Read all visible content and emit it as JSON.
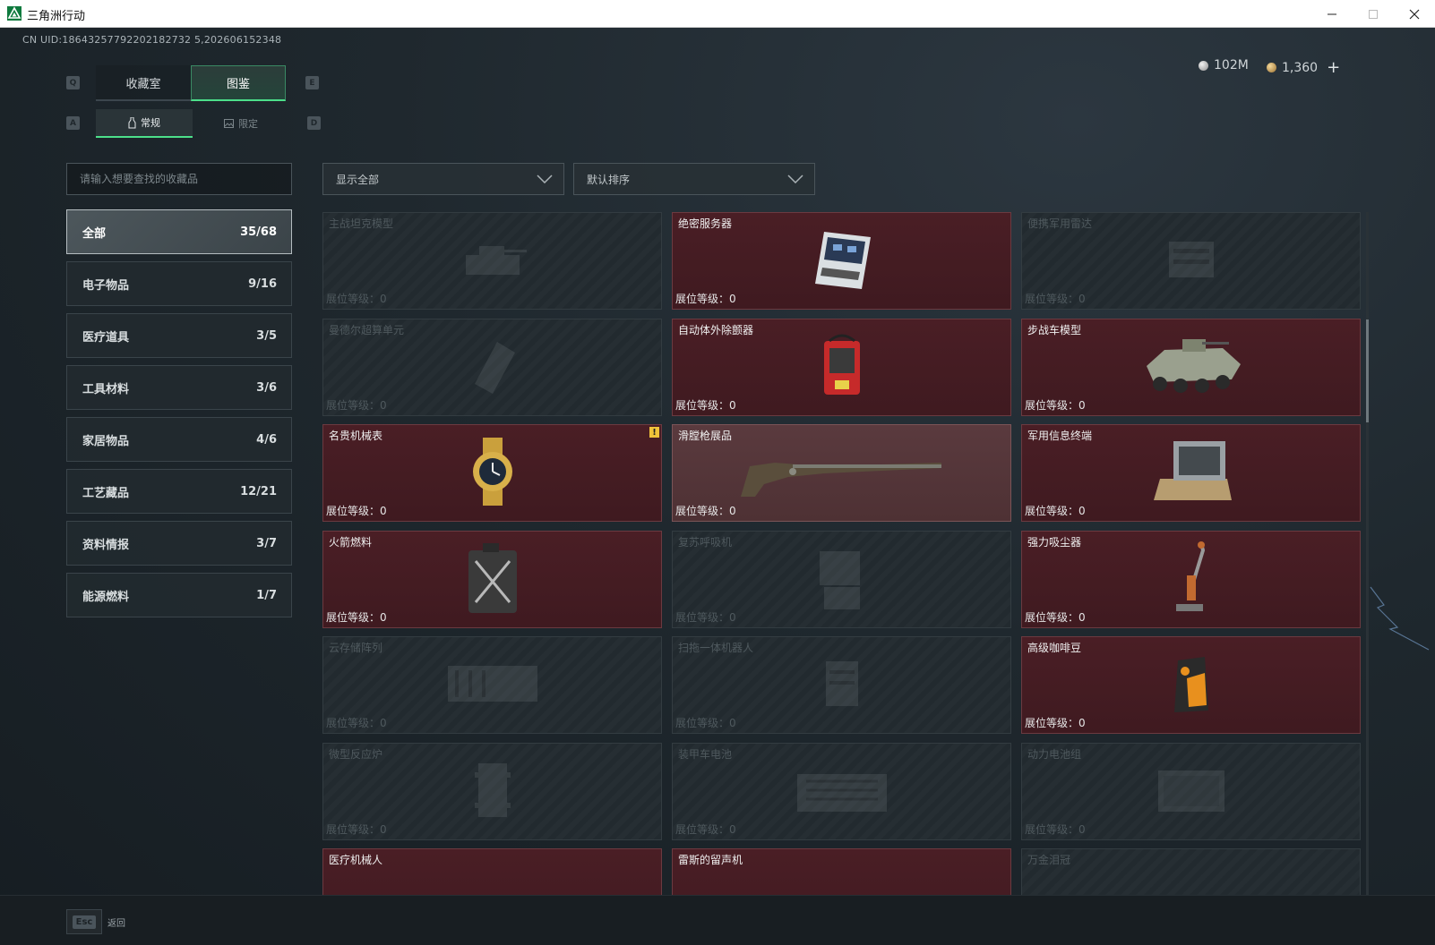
{
  "window": {
    "title": "三角洲行动"
  },
  "uid_text": "CN UID:18643257792202182732 5,202606152348",
  "currency": {
    "silver": "102M",
    "gold": "1,360",
    "plus": "+"
  },
  "keys": {
    "q": "Q",
    "e": "E",
    "a": "A",
    "d": "D",
    "esc": "Esc"
  },
  "tabs": [
    {
      "label": "收藏室"
    },
    {
      "label": "图鉴"
    }
  ],
  "subtabs": [
    {
      "label": "常规"
    },
    {
      "label": "限定"
    }
  ],
  "search": {
    "placeholder": "请输入想要查找的收藏品"
  },
  "categories": [
    {
      "label": "全部",
      "count": "35/68"
    },
    {
      "label": "电子物品",
      "count": "9/16"
    },
    {
      "label": "医疗道具",
      "count": "3/5"
    },
    {
      "label": "工具材料",
      "count": "3/6"
    },
    {
      "label": "家居物品",
      "count": "4/6"
    },
    {
      "label": "工艺藏品",
      "count": "12/21"
    },
    {
      "label": "资料情报",
      "count": "3/7"
    },
    {
      "label": "能源燃料",
      "count": "1/7"
    }
  ],
  "filters": {
    "show": "显示全部",
    "sort": "默认排序"
  },
  "level_label": "展位等级：",
  "items": [
    {
      "name": "主战坦克模型",
      "level": "0",
      "state": "locked",
      "icon": "tank-icon"
    },
    {
      "name": "绝密服务器",
      "level": "0",
      "state": "owned",
      "icon": "server-icon"
    },
    {
      "name": "便携军用雷达",
      "level": "0",
      "state": "locked",
      "icon": "radar-icon"
    },
    {
      "name": "曼德尔超算单元",
      "level": "0",
      "state": "locked",
      "icon": "supercomputer-icon"
    },
    {
      "name": "自动体外除颤器",
      "level": "0",
      "state": "owned",
      "icon": "defibrillator-icon"
    },
    {
      "name": "步战车模型",
      "level": "0",
      "state": "owned",
      "icon": "ifv-icon"
    },
    {
      "name": "名贵机械表",
      "level": "0",
      "state": "owned",
      "icon": "watch-icon",
      "warn": "!"
    },
    {
      "name": "滑膛枪展品",
      "level": "0",
      "state": "special",
      "icon": "musket-icon"
    },
    {
      "name": "军用信息终端",
      "level": "0",
      "state": "owned",
      "icon": "terminal-icon"
    },
    {
      "name": "火箭燃料",
      "level": "0",
      "state": "owned",
      "icon": "fuel-can-icon"
    },
    {
      "name": "复苏呼吸机",
      "level": "0",
      "state": "locked",
      "icon": "ventilator-icon"
    },
    {
      "name": "强力吸尘器",
      "level": "0",
      "state": "owned",
      "icon": "vacuum-icon"
    },
    {
      "name": "云存储阵列",
      "level": "0",
      "state": "locked",
      "icon": "storage-icon"
    },
    {
      "name": "扫拖一体机器人",
      "level": "0",
      "state": "locked",
      "icon": "robot-icon"
    },
    {
      "name": "高级咖啡豆",
      "level": "0",
      "state": "owned",
      "icon": "coffee-icon"
    },
    {
      "name": "微型反应炉",
      "level": "0",
      "state": "locked",
      "icon": "reactor-icon"
    },
    {
      "name": "装甲车电池",
      "level": "0",
      "state": "locked",
      "icon": "battery-icon"
    },
    {
      "name": "动力电池组",
      "level": "0",
      "state": "locked",
      "icon": "battery-pack-icon"
    },
    {
      "name": "医疗机械人",
      "level": "",
      "state": "owned",
      "icon": "medical-robot-icon"
    },
    {
      "name": "雷斯的留声机",
      "level": "",
      "state": "owned",
      "icon": "gramophone-icon"
    },
    {
      "name": "万金泪冠",
      "level": "",
      "state": "locked",
      "icon": "crown-icon"
    }
  ],
  "bottom": {
    "back_label": "返回"
  },
  "colors": {
    "accent": "#4ce08a",
    "owned": "#4a1e25",
    "locked": "#222a2f",
    "warn": "#f0c33a"
  }
}
